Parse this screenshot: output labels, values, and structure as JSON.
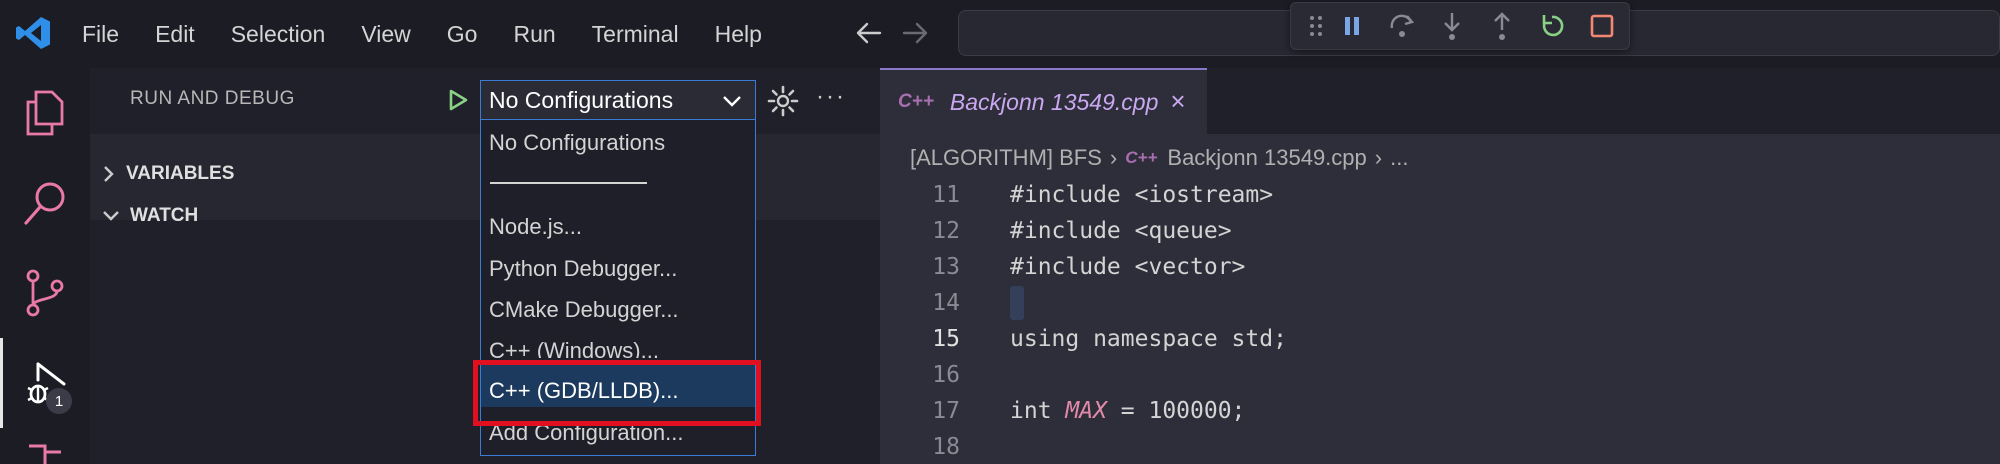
{
  "menu": [
    "File",
    "Edit",
    "Selection",
    "View",
    "Go",
    "Run",
    "Terminal",
    "Help"
  ],
  "icons": {
    "app": "vscode-logo-icon",
    "back": "arrow-left-icon",
    "forward": "arrow-right-icon",
    "debug_toolbar": [
      "drag-grip-icon",
      "pause-icon",
      "step-over-icon",
      "step-into-icon",
      "step-out-icon",
      "restart-icon",
      "stop-icon"
    ],
    "activity": [
      "explorer-icon",
      "search-icon",
      "source-control-icon",
      "run-debug-icon"
    ]
  },
  "activity": {
    "debug_badge": "1"
  },
  "sidebar": {
    "title": "RUN AND DEBUG",
    "sections": [
      "VARIABLES",
      "WATCH"
    ]
  },
  "config": {
    "selected": "No Configurations",
    "options": [
      "No Configurations",
      "Node.js...",
      "Python Debugger...",
      "CMake Debugger...",
      "C++ (Windows)...",
      "C++ (GDB/LLDB)...",
      "Add Configuration..."
    ]
  },
  "editor": {
    "tab_icon": "C++",
    "tab_label": "Backjonn 13549.cpp",
    "breadcrumb": {
      "folder": "[ALGORITHM] BFS",
      "file_icon": "C++",
      "file": "Backjonn 13549.cpp",
      "tail": "..."
    },
    "lines": [
      {
        "num": "11",
        "text": "#include <iostream>"
      },
      {
        "num": "12",
        "text": "#include <queue>"
      },
      {
        "num": "13",
        "text": "#include <vector>"
      },
      {
        "num": "14",
        "text": ""
      },
      {
        "num": "15",
        "text": "using namespace std;"
      },
      {
        "num": "16",
        "text": ""
      },
      {
        "num": "17",
        "pre": "int ",
        "ident": "MAX",
        "post": " = 100000;"
      },
      {
        "num": "18",
        "text": ""
      }
    ]
  },
  "colors": {
    "accent": "#3a7bd5",
    "highlight_box": "#e01020",
    "tab_label": "#c9a8f0",
    "run_green": "#89d185"
  }
}
